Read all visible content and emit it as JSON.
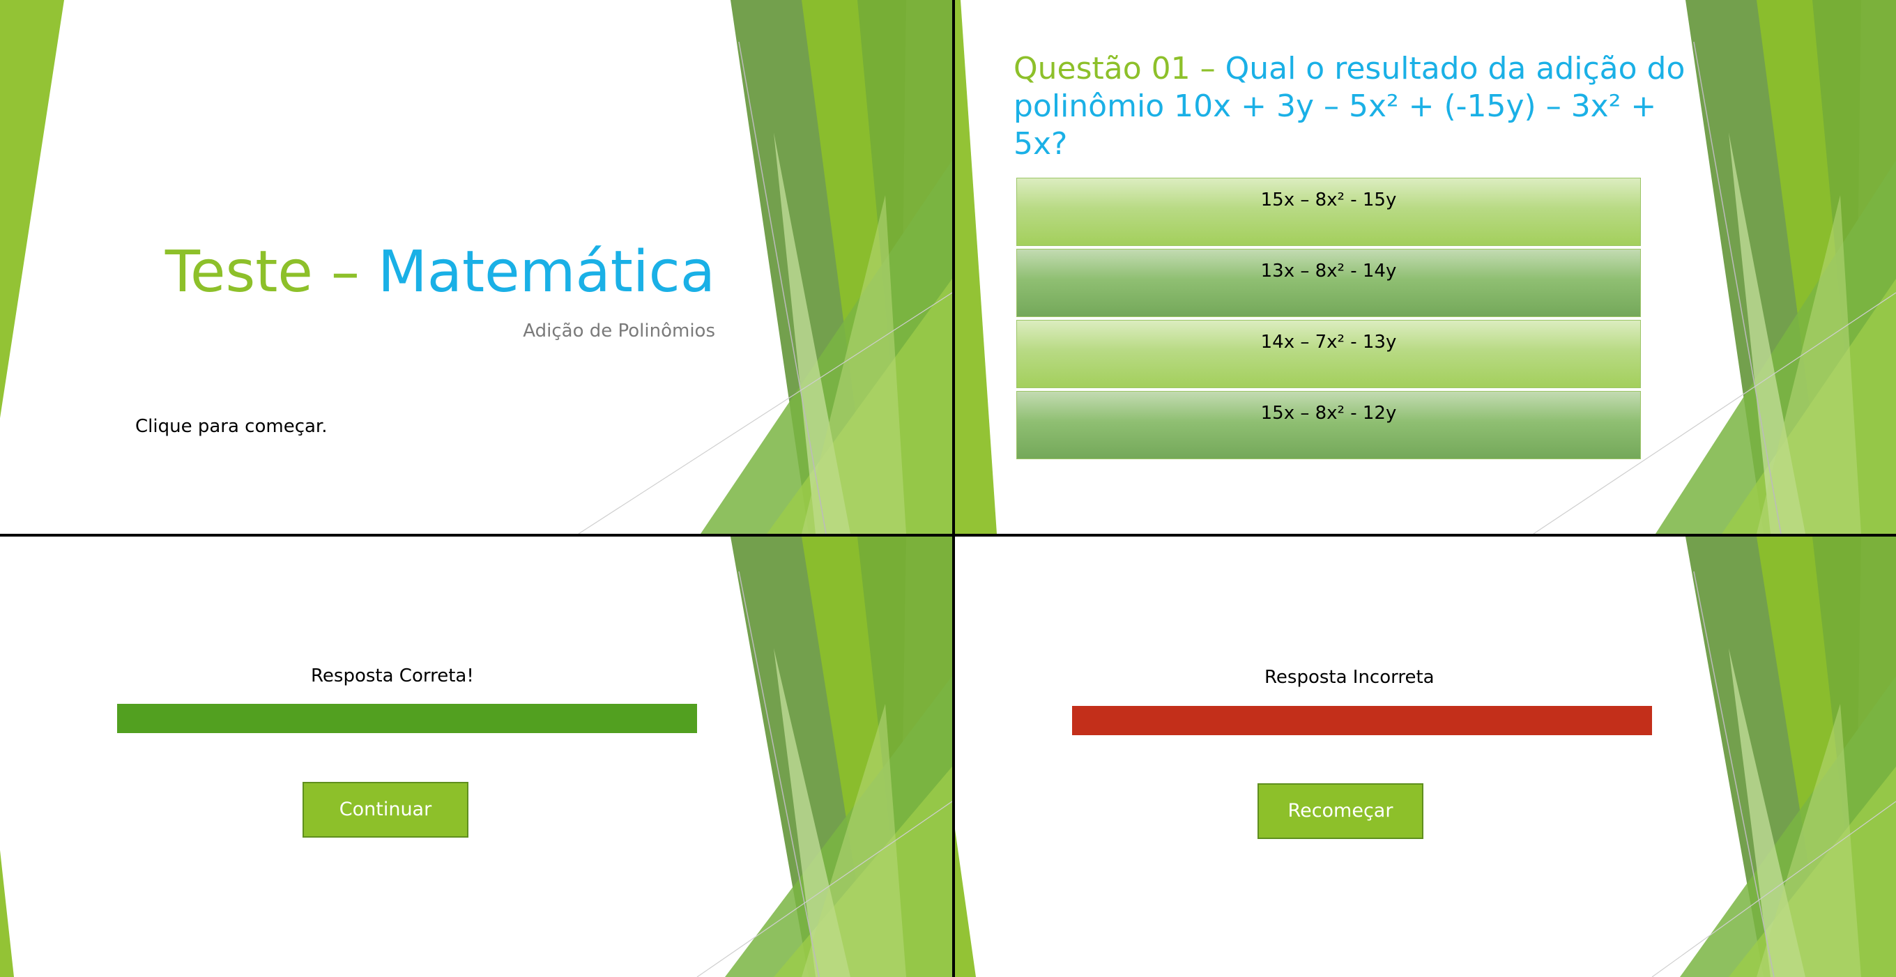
{
  "title_slide": {
    "title_part1": "Teste",
    "title_separator": "–",
    "title_part2": "Matemática",
    "subtitle": "Adição de Polinômios",
    "start_hint": "Clique para começar."
  },
  "question_slide": {
    "label": "Questão 01 –",
    "text": "Qual o resultado da adição do polinômio 10x + 3y – 5x² + (-15y) – 3x² + 5x?",
    "options": [
      "15x – 8x² - 15y",
      "13x – 8x² - 14y",
      "14x – 7x² - 13y",
      "15x – 8x² - 12y"
    ]
  },
  "correct_slide": {
    "message": "Resposta Correta!",
    "button_label": "Continuar",
    "bar_color": "#52a020"
  },
  "wrong_slide": {
    "message": "Resposta Incorreta",
    "button_label": "Recomeçar",
    "bar_color": "#c32f1a"
  },
  "colors": {
    "accent_green": "#8dc02a",
    "accent_blue": "#1ab0e6",
    "dark_green": "#5a9a2a"
  }
}
